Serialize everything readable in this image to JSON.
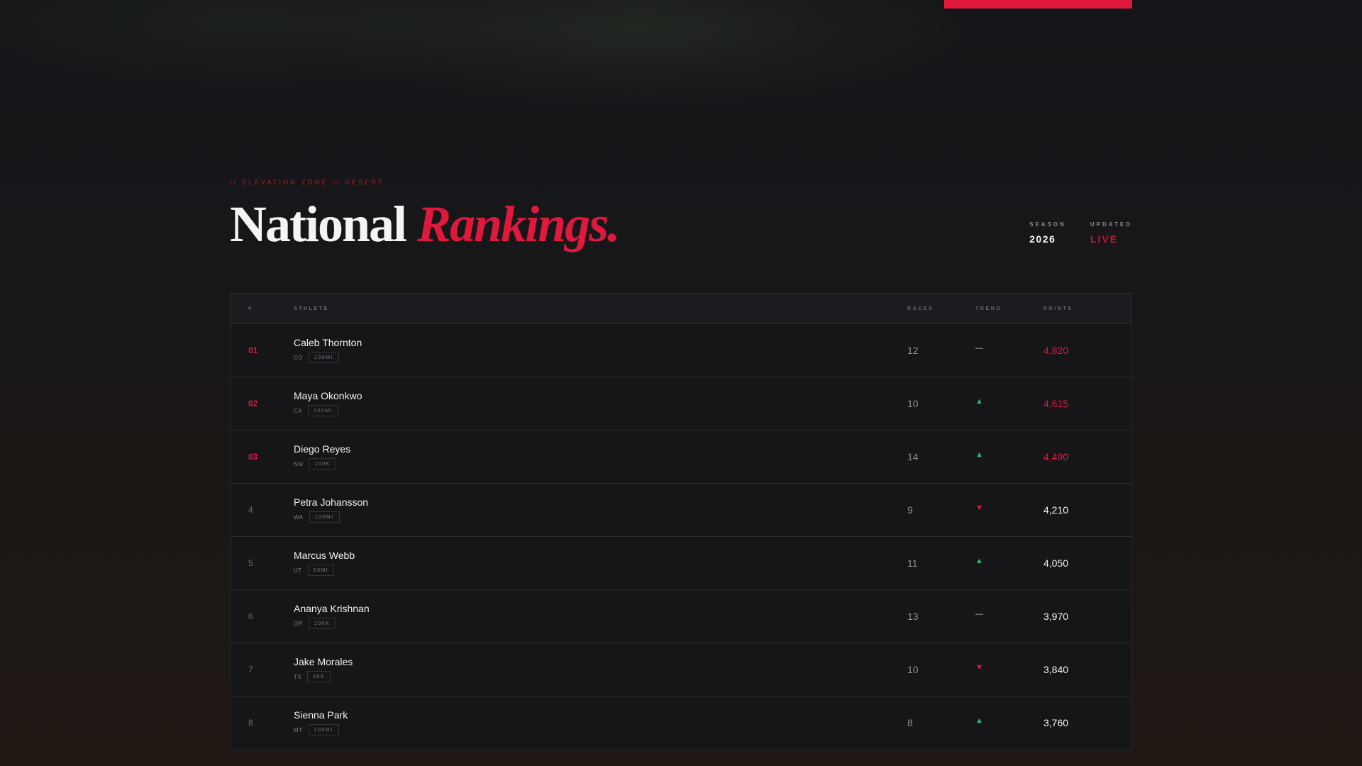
{
  "header": {
    "eyebrow": "// ELEVATION ZONE — DESERT",
    "title_plain": "National",
    "title_accent": "Rankings.",
    "meta": [
      {
        "label": "SEASON",
        "value": "2026"
      },
      {
        "label": "UPDATED",
        "value": "LIVE"
      }
    ]
  },
  "colors": {
    "accent": "#e0183c",
    "trend_up": "#2bb673",
    "background": "#17171a"
  },
  "table": {
    "columns": [
      "#",
      "ATHLETE",
      "RACES",
      "TREND",
      "POINTS"
    ],
    "rows": [
      {
        "rank": "01",
        "name": "Caleb Thornton",
        "state": "CO",
        "tag": "100MI",
        "races": "12",
        "trend": "—",
        "trend_dir": "flat",
        "points": "4,820",
        "top": true
      },
      {
        "rank": "02",
        "name": "Maya Okonkwo",
        "state": "CA",
        "tag": "100MI",
        "races": "10",
        "trend": "▲",
        "trend_dir": "up",
        "points": "4,615",
        "top": true
      },
      {
        "rank": "03",
        "name": "Diego Reyes",
        "state": "NM",
        "tag": "100K",
        "races": "14",
        "trend": "▲",
        "trend_dir": "up",
        "points": "4,490",
        "top": true
      },
      {
        "rank": "4",
        "name": "Petra Johansson",
        "state": "WA",
        "tag": "100MI",
        "races": "9",
        "trend": "▼",
        "trend_dir": "down",
        "points": "4,210",
        "top": false
      },
      {
        "rank": "5",
        "name": "Marcus Webb",
        "state": "UT",
        "tag": "50MI",
        "races": "11",
        "trend": "▲",
        "trend_dir": "up",
        "points": "4,050",
        "top": false
      },
      {
        "rank": "6",
        "name": "Ananya Krishnan",
        "state": "OR",
        "tag": "100K",
        "races": "13",
        "trend": "—",
        "trend_dir": "flat",
        "points": "3,970",
        "top": false
      },
      {
        "rank": "7",
        "name": "Jake Morales",
        "state": "TX",
        "tag": "50K",
        "races": "10",
        "trend": "▼",
        "trend_dir": "down",
        "points": "3,840",
        "top": false
      },
      {
        "rank": "8",
        "name": "Sienna Park",
        "state": "MT",
        "tag": "100MI",
        "races": "8",
        "trend": "▲",
        "trend_dir": "up",
        "points": "3,760",
        "top": false
      }
    ]
  }
}
